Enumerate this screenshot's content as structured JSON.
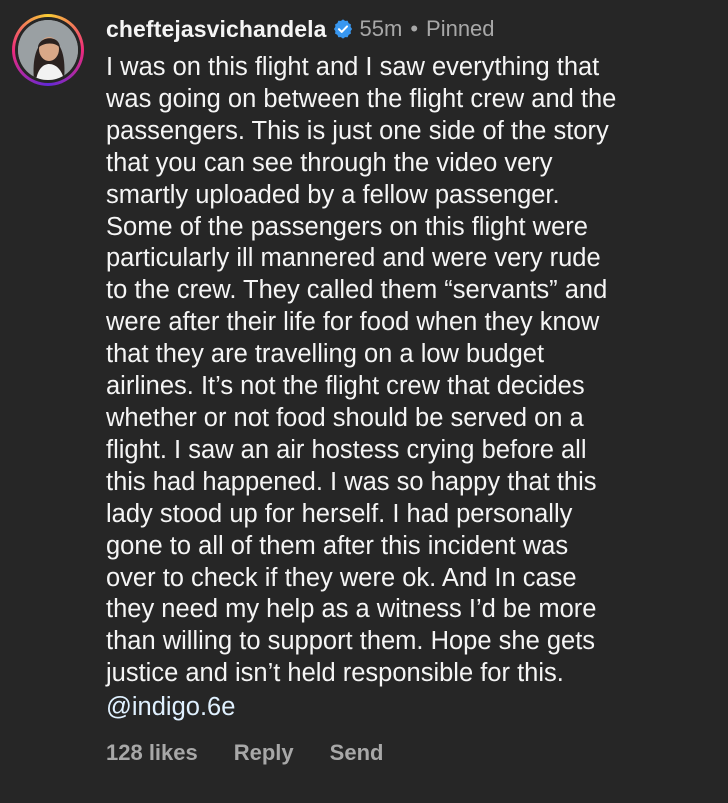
{
  "comment": {
    "username": "cheftejasvichandela",
    "verified_icon": "verified-badge-icon",
    "timestamp": "55m",
    "separator": "•",
    "pinned_label": "Pinned",
    "lines": [
      "I was on this flight and I saw everything that",
      "was going on between the flight crew and the",
      "passengers. This is just one side of the story",
      "that you can see through the video very",
      "smartly uploaded by a fellow passenger.",
      "Some of the passengers on this flight were",
      "particularly ill mannered and were very rude",
      "to the crew. They called them “servants” and",
      "were after their life for food when they know",
      "that they are travelling on a low budget",
      "airlines. It’s not the flight crew that decides",
      "whether or not food should be served on a",
      "flight. I saw an air hostess crying before all",
      "this had happened. I was so happy that this",
      "lady stood up for herself. I had personally",
      "gone to all of them after this incident was",
      "over to check if they were ok. And In case",
      "they need my help as a witness I’d be more",
      "than willing to support them. Hope she gets",
      "justice and isn’t held responsible for this."
    ],
    "mention": "@indigo.6e",
    "likes": "128 likes",
    "reply_label": "Reply",
    "send_label": "Send"
  },
  "colors": {
    "background": "#262626",
    "text": "#f5f5f5",
    "muted": "#a8a8a8",
    "mention": "#e0f1ff",
    "verified": "#3897f0"
  }
}
